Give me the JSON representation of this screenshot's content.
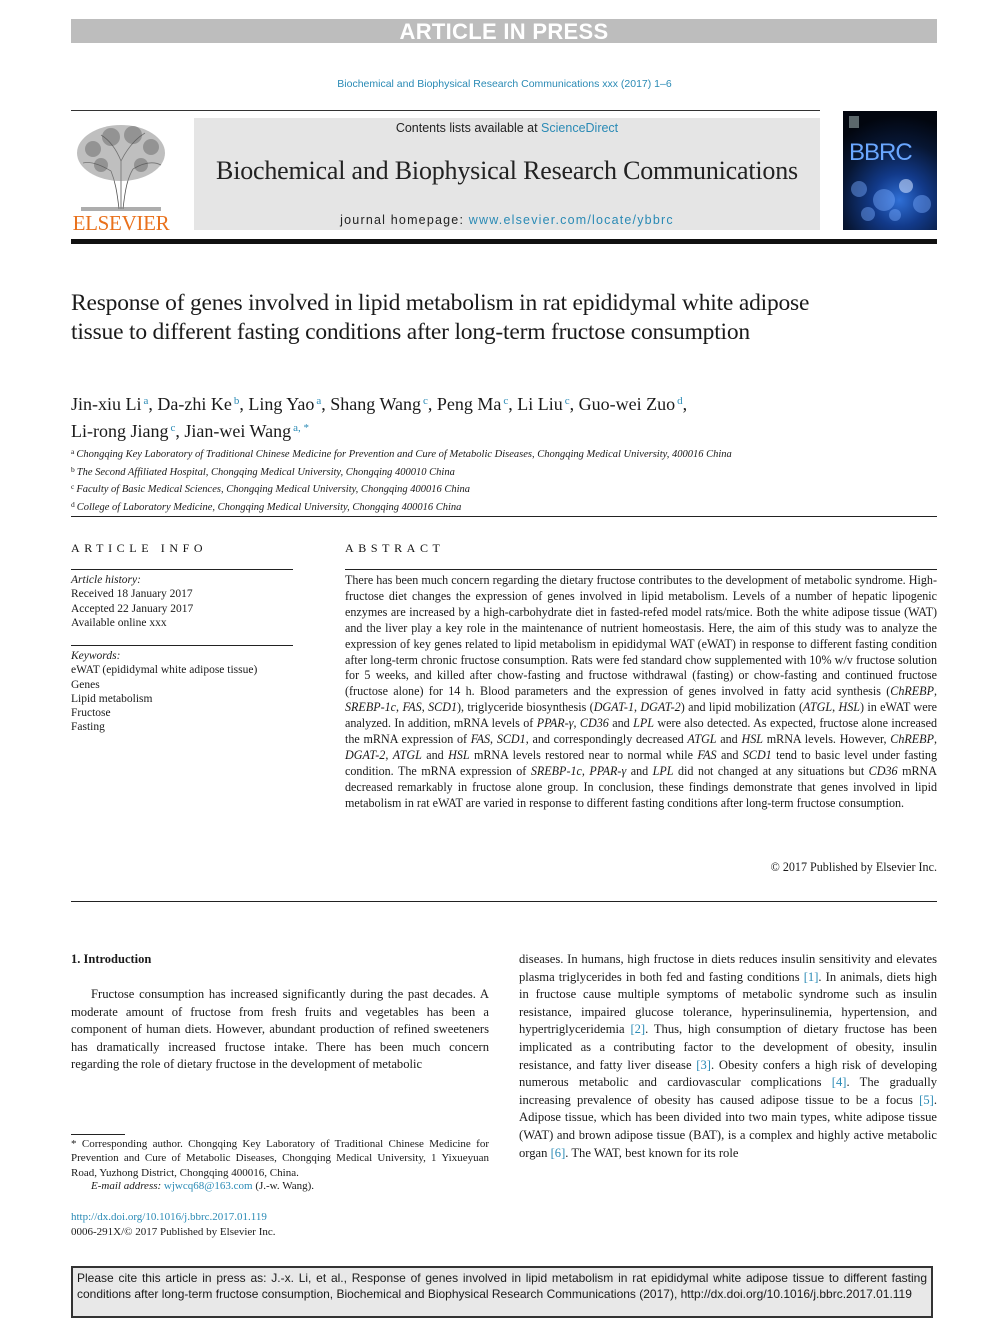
{
  "banner": {
    "label": "ARTICLE IN PRESS"
  },
  "journal_ref": "Biochemical and Biophysical Research Communications xxx (2017) 1–6",
  "header": {
    "publisher_logo": "ELSEVIER",
    "contents_prefix": "Contents lists available at ",
    "contents_link": "ScienceDirect",
    "journal_title": "Biochemical and Biophysical Research Communications",
    "homepage_prefix": "journal homepage: ",
    "homepage_link": "www.elsevier.com/locate/ybbrc",
    "cover_label": "BBRC"
  },
  "article": {
    "title": "Response of genes involved in lipid metabolism in rat epididymal white adipose tissue to different fasting conditions after long-term fructose consumption",
    "authors": [
      {
        "name": "Jin-xiu Li",
        "aff": "a"
      },
      {
        "name": "Da-zhi Ke",
        "aff": "b"
      },
      {
        "name": "Ling Yao",
        "aff": "a"
      },
      {
        "name": "Shang Wang",
        "aff": "c"
      },
      {
        "name": "Peng Ma",
        "aff": "c"
      },
      {
        "name": "Li Liu",
        "aff": "c"
      },
      {
        "name": "Guo-wei Zuo",
        "aff": "d"
      },
      {
        "name": "Li-rong Jiang",
        "aff": "c"
      },
      {
        "name": "Jian-wei Wang",
        "aff": "a, *"
      }
    ],
    "affiliations": [
      {
        "key": "a",
        "text": "Chongqing Key Laboratory of Traditional Chinese Medicine for Prevention and Cure of Metabolic Diseases, Chongqing Medical University, 400016 China"
      },
      {
        "key": "b",
        "text": "The Second Affiliated Hospital, Chongqing Medical University, Chongqing 400010 China"
      },
      {
        "key": "c",
        "text": "Faculty of Basic Medical Sciences, Chongqing Medical University, Chongqing 400016 China"
      },
      {
        "key": "d",
        "text": "College of Laboratory Medicine, Chongqing Medical University, Chongqing 400016 China"
      }
    ]
  },
  "article_info": {
    "heading": "ARTICLE INFO",
    "history_label": "Article history:",
    "history": [
      "Received 18 January 2017",
      "Accepted 22 January 2017",
      "Available online xxx"
    ],
    "keywords_label": "Keywords:",
    "keywords": [
      "eWAT (epididymal white adipose tissue)",
      "Genes",
      "Lipid metabolism",
      "Fructose",
      "Fasting"
    ]
  },
  "abstract": {
    "heading": "ABSTRACT",
    "p1": "There has been much concern regarding the dietary fructose contributes to the development of metabolic syndrome. High-fructose diet changes the expression of genes involved in lipid metabolism. Levels of a number of hepatic lipogenic enzymes are increased by a high-carbohydrate diet in fasted-refed model rats/mice. Both the white adipose tissue (WAT) and the liver play a key role in the maintenance of nutrient homeostasis. Here, the aim of this study was to analyze the expression of key genes related to lipid metabolism in epididymal WAT (eWAT) in response to different fasting condition after long-term chronic fructose consumption. Rats were fed standard chow supplemented with 10% w/v fructose solution for 5 weeks, and killed after chow-fasting and fructose withdrawal (fasting) or chow-fasting and continued fructose (fructose alone) for 14 h. Blood parameters and the expression of genes involved in fatty acid synthesis (",
    "g_chrebp": "ChREBP",
    "g_srebp": "SREBP-1c",
    "g_fas": "FAS",
    "g_scd1": "SCD1",
    "g_dgat1": "DGAT-1",
    "g_dgat2": "DGAT-2",
    "g_atgl": "ATGL",
    "g_hsl": "HSL",
    "g_ppar": "PPAR-γ",
    "g_cd36": "CD36",
    "g_lpl": "LPL",
    "t_tri": "), triglyceride biosynthesis (",
    "t_lipmob": ") and lipid mobilization (",
    "t_ewat": ") in eWAT were analyzed. In addition, mRNA levels of ",
    "t_and": " and ",
    "t_comma": ", ",
    "t_expected": " were also detected. As expected, fructose alone increased the mRNA expression of ",
    "t_corr": ", and correspondingly decreased ",
    "t_however": " mRNA levels. However, ",
    "t_restored": " mRNA levels restored near to normal while ",
    "t_tend": " tend to basic level under fasting condition. The mRNA expression of ",
    "t_notchanged": " did not changed at any situations but ",
    "t_conclusion": " mRNA decreased remarkably in fructose alone group. In conclusion, these findings demonstrate that genes involved in lipid metabolism in rat eWAT are varied in response to different fasting conditions after long-term fructose consumption.",
    "copyright": "© 2017 Published by Elsevier Inc."
  },
  "intro": {
    "heading": "1.  Introduction",
    "left_para": "Fructose consumption has increased significantly during the past decades. A moderate amount of fructose from fresh fruits and vegetables has been a component of human diets. However, abundant production of refined sweeteners has dramatically increased fructose intake. There has been much concern regarding the role of dietary fructose in the development of metabolic",
    "r1": "diseases. In humans, high fructose in diets reduces insulin sensitivity and elevates plasma triglycerides in both fed and fasting conditions ",
    "ref1": "[1]",
    "r2": ". In animals, diets high in fructose cause multiple symptoms of metabolic syndrome such as insulin resistance, impaired glucose tolerance, hyperinsulinemia, hypertension, and hypertriglyceridemia ",
    "ref2": "[2]",
    "r3": ". Thus, high consumption of dietary fructose has been implicated as a contributing factor to the development of obesity, insulin resistance, and fatty liver disease ",
    "ref3": "[3]",
    "r4": ". Obesity confers a high risk of developing numerous metabolic and cardiovascular complications ",
    "ref4": "[4]",
    "r5": ". The gradually increasing prevalence of obesity has caused adipose tissue to be a focus ",
    "ref5": "[5]",
    "r6": ". Adipose tissue, which has been divided into two main types, white adipose tissue (WAT) and brown adipose tissue (BAT), is a complex and highly active metabolic organ ",
    "ref6": "[6]",
    "r7": ". The WAT, best known for its role"
  },
  "footnote": {
    "corresponding": "* Corresponding author. Chongqing Key Laboratory of Traditional Chinese Medicine for Prevention and Cure of Metabolic Diseases, Chongqing Medical University, 1 Yixueyuan Road, Yuzhong District, Chongqing 400016, China.",
    "email_label": "E-mail address: ",
    "email": "wjwcq68@163.com",
    "email_suffix": " (J.-w. Wang).",
    "doi": "http://dx.doi.org/10.1016/j.bbrc.2017.01.119",
    "issn": "0006-291X/© 2017 Published by Elsevier Inc."
  },
  "cite_box": "Please cite this article in press as: J.-x. Li, et al., Response of genes involved in lipid metabolism in rat epididymal white adipose tissue to different fasting conditions after long-term fructose consumption, Biochemical and Biophysical Research Communications (2017), http://dx.doi.org/10.1016/j.bbrc.2017.01.119"
}
